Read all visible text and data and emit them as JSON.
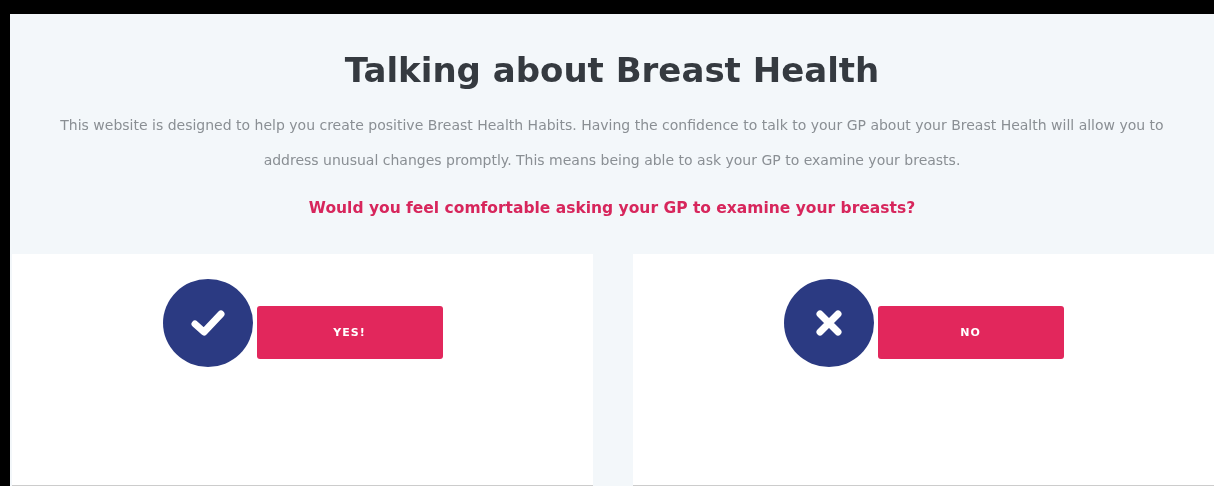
{
  "title": "Talking about Breast Health",
  "intro": "This website is designed to help you create positive Breast Health Habits. Having the confidence to talk to your GP about your Breast Health will allow you to address unusual changes promptly. This means being able to ask your GP to examine your breasts.",
  "question": "Would you feel comfortable asking your GP to examine your breasts?",
  "answers": [
    {
      "kind": "check",
      "label": "YES!"
    },
    {
      "kind": "cross",
      "label": "NO"
    }
  ]
}
